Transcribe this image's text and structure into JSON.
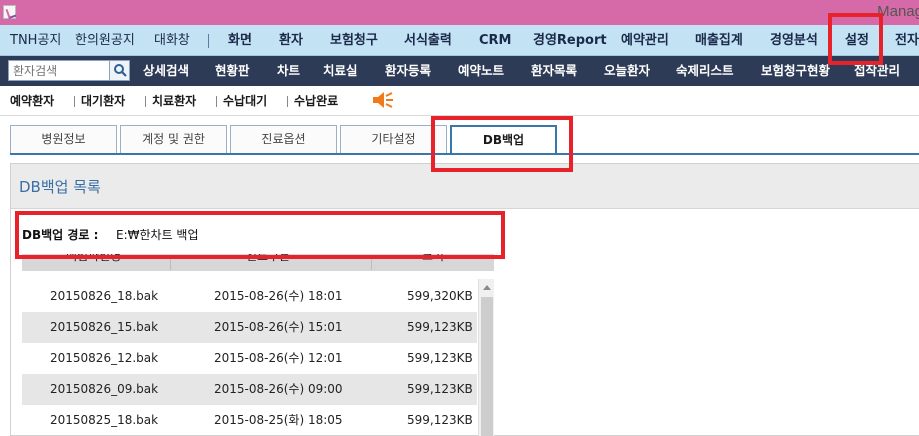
{
  "window": {
    "title": "Manag"
  },
  "main_menu": [
    {
      "label": "TNH공지",
      "bold": false
    },
    {
      "label": "한의원공지",
      "bold": false
    },
    {
      "label": "대화창",
      "bold": false
    },
    {
      "label": "화면",
      "bold": true
    },
    {
      "label": "환자",
      "bold": true
    },
    {
      "label": "보험청구",
      "bold": true
    },
    {
      "label": "서식출력",
      "bold": true
    },
    {
      "label": "CRM",
      "bold": true
    },
    {
      "label": "경영Report",
      "bold": true
    },
    {
      "label": "예약관리",
      "bold": true
    },
    {
      "label": "매출집계",
      "bold": true
    },
    {
      "label": "경영분석",
      "bold": true
    },
    {
      "label": "설정",
      "bold": true
    },
    {
      "label": "전자",
      "bold": true
    }
  ],
  "search": {
    "placeholder": "환자검색",
    "icon": "search-icon"
  },
  "sub_menu": [
    "상세검색",
    "현황판",
    "차트",
    "치료실",
    "환자등록",
    "예약노트",
    "환자목록",
    "오늘환자",
    "숙제리스트",
    "보험청구현황",
    "접작관리"
  ],
  "quick_bar": [
    "예약환자",
    "대기환자",
    "치료환자",
    "수납대기",
    "수납완료"
  ],
  "quick_icon": "speaker-icon",
  "tabs": [
    {
      "label": "병원정보",
      "active": false
    },
    {
      "label": "계정 및 권한",
      "active": false
    },
    {
      "label": "진료옵션",
      "active": false
    },
    {
      "label": "기타설정",
      "active": false
    },
    {
      "label": "DB백업",
      "active": true
    }
  ],
  "panel": {
    "title": "DB백업 목록",
    "path_label": "DB백업 경로 :",
    "path_value": "E:₩한차트 백업"
  },
  "table": {
    "headers": [
      "백업파일명",
      "진료구분",
      "크기"
    ],
    "rows": [
      {
        "file": "20150826_18.bak",
        "date": "2015-08-26(수) 18:01",
        "size": "599,320KB"
      },
      {
        "file": "20150826_15.bak",
        "date": "2015-08-26(수) 15:01",
        "size": "599,123KB"
      },
      {
        "file": "20150826_12.bak",
        "date": "2015-08-26(수) 12:01",
        "size": "599,123KB"
      },
      {
        "file": "20150826_09.bak",
        "date": "2015-08-26(수) 09:00",
        "size": "599,123KB"
      },
      {
        "file": "20150825_18.bak",
        "date": "2015-08-25(화) 18:05",
        "size": "599,123KB"
      }
    ]
  },
  "colors": {
    "title_bar": "#d66aa8",
    "main_menu_bg": "#c3e2f3",
    "sub_menu_bg": "#2e3b57",
    "accent": "#3b76a8",
    "highlight": "#e8222b"
  }
}
